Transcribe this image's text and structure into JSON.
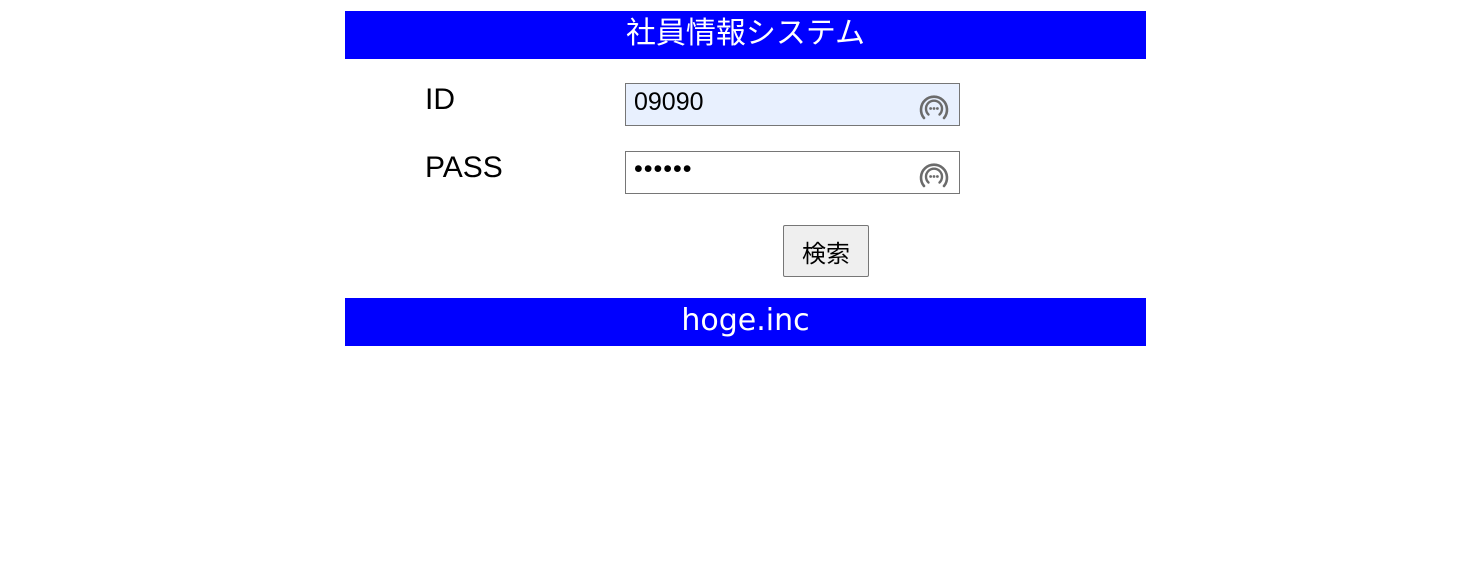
{
  "header": {
    "title": "社員情報システム"
  },
  "form": {
    "id_label": "ID",
    "id_value": "09090",
    "pass_label": "PASS",
    "pass_value": "••••••",
    "search_label": "検索"
  },
  "footer": {
    "text": "hoge.inc"
  },
  "icons": {
    "field_icon": "password-manager-icon"
  },
  "colors": {
    "banner_bg": "#0000ff",
    "banner_text": "#ffffff",
    "autofill_bg": "#e8f0fe"
  }
}
